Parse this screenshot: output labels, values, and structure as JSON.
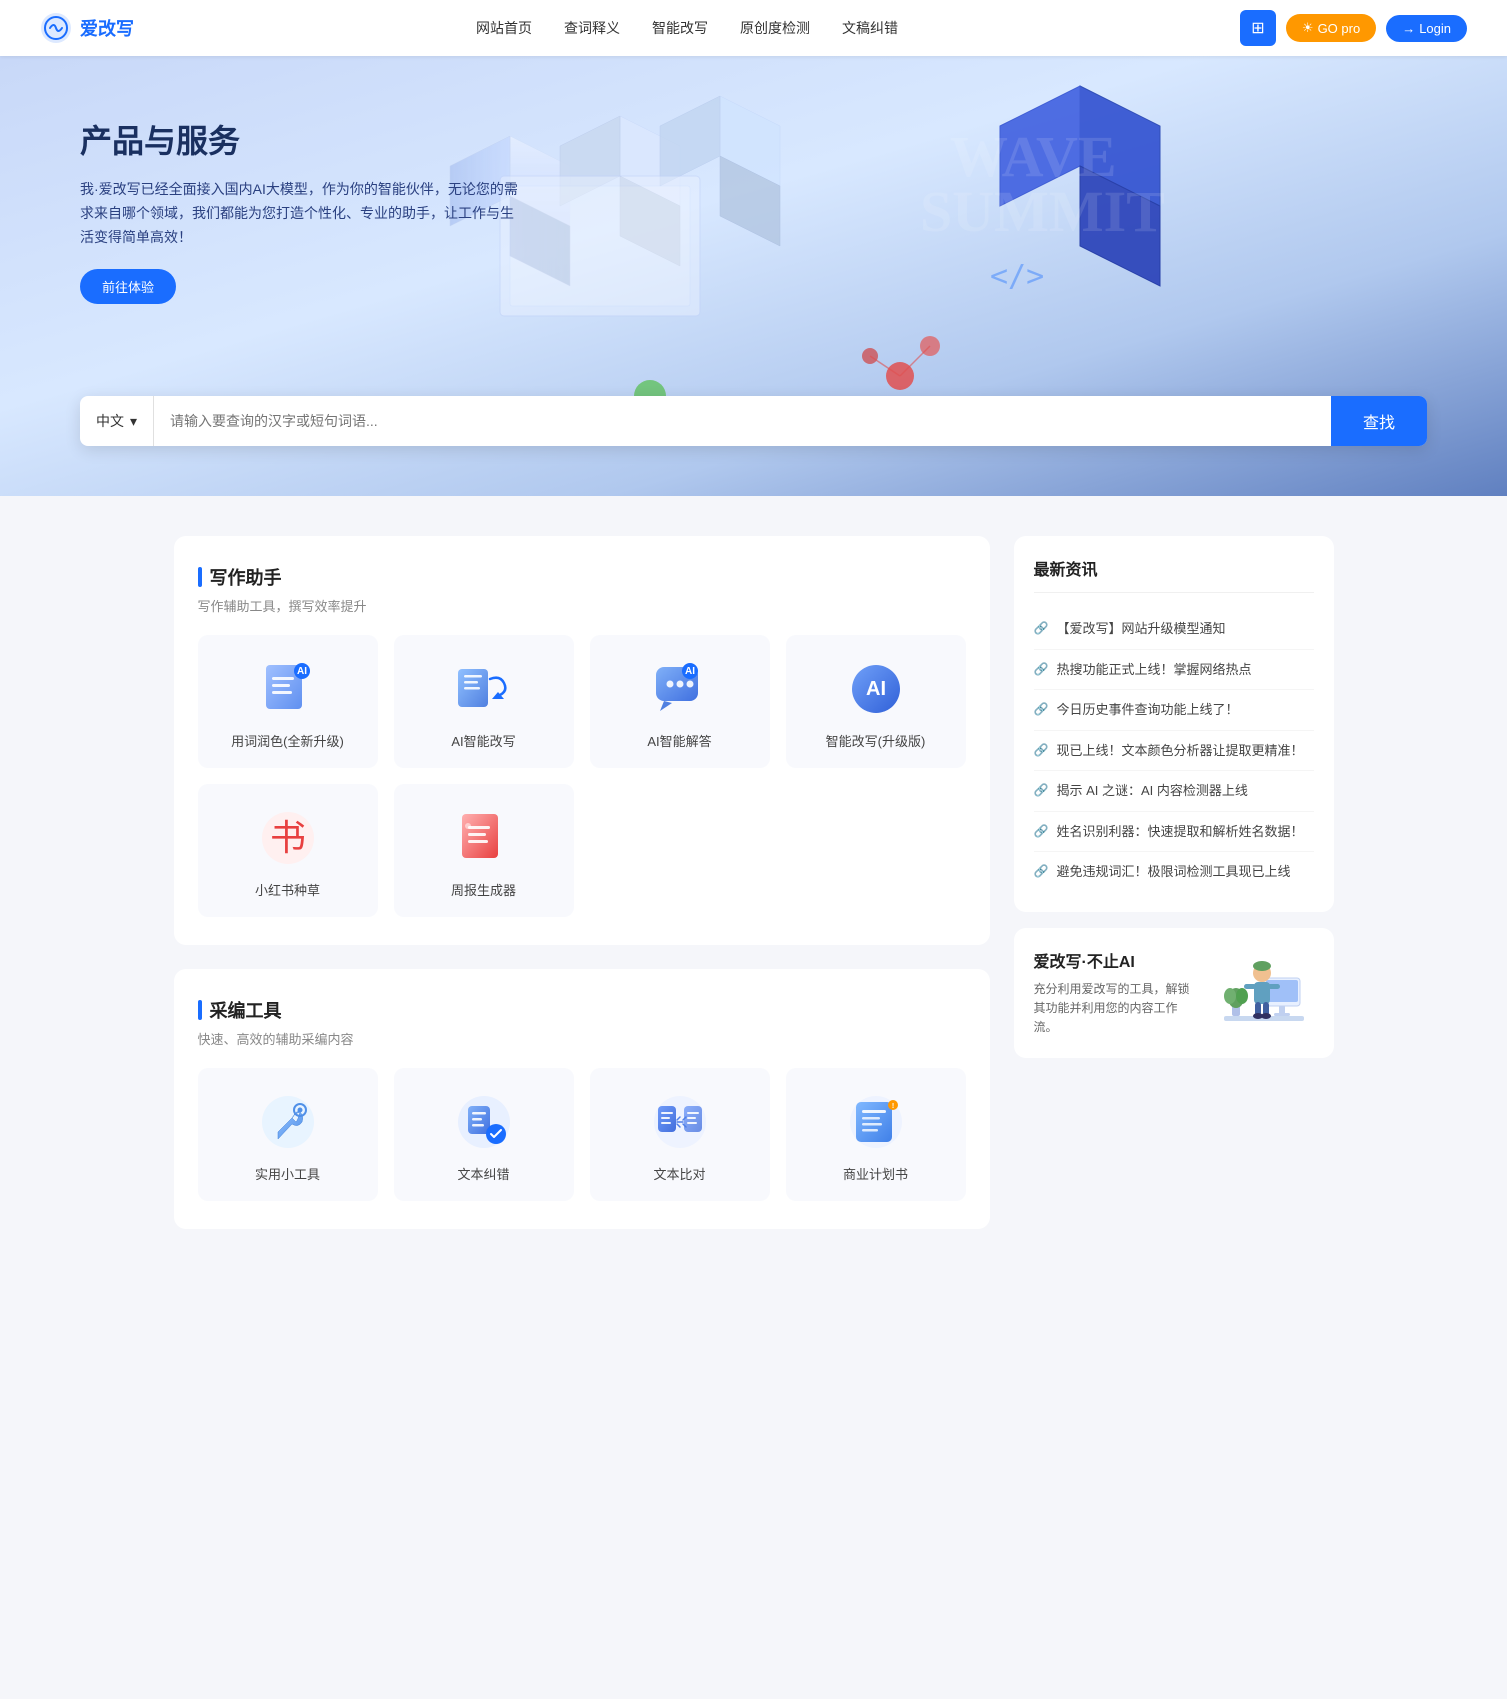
{
  "header": {
    "logo_text": "爱改写",
    "nav_items": [
      "网站首页",
      "查词释义",
      "智能改写",
      "原创度检测",
      "文稿纠错"
    ],
    "btn_grid_label": "⊞",
    "btn_go_label": "GO pro",
    "btn_login_label": "Login"
  },
  "hero": {
    "title": "产品与服务",
    "desc": "我·爱改写已经全面接入国内AI大模型，作为你的智能伙伴，无论您的需求来自哪个领域，我们都能为您打造个性化、专业的助手，让工作与生活变得简单高效！",
    "btn_experience": "前往体验",
    "wave_text": "WAVE SUMMIT",
    "search_lang": "中文",
    "search_placeholder": "请输入要查询的汉字或短句词语...",
    "search_btn": "查找"
  },
  "writing_section": {
    "title": "写作助手",
    "desc": "写作辅助工具，撰写效率提升",
    "tools": [
      {
        "id": "word-polish",
        "label": "用词润色(全新升级)",
        "icon_type": "writing"
      },
      {
        "id": "ai-rewrite",
        "label": "AI智能改写",
        "icon_type": "rewrite"
      },
      {
        "id": "ai-answer",
        "label": "AI智能解答",
        "icon_type": "answer"
      },
      {
        "id": "smart-rewrite-pro",
        "label": "智能改写(升级版)",
        "icon_type": "smart"
      },
      {
        "id": "xiaohongshu",
        "label": "小红书种草",
        "icon_type": "xiaohongshu"
      },
      {
        "id": "weekly-report",
        "label": "周报生成器",
        "icon_type": "weekly"
      }
    ]
  },
  "tools_section": {
    "title": "采编工具",
    "desc": "快速、高效的辅助采编内容",
    "tools": [
      {
        "id": "practical-tools",
        "label": "实用小工具",
        "icon_type": "tools"
      },
      {
        "id": "text-correct",
        "label": "文本纠错",
        "icon_type": "correct"
      },
      {
        "id": "text-compare",
        "label": "文本比对",
        "icon_type": "compare"
      },
      {
        "id": "business-plan",
        "label": "商业计划书",
        "icon_type": "plan"
      }
    ]
  },
  "news": {
    "title": "最新资讯",
    "items": [
      "【爱改写】网站升级模型通知",
      "热搜功能正式上线！掌握网络热点",
      "今日历史事件查询功能上线了！",
      "现已上线！文本颜色分析器让提取更精准！",
      "揭示 AI 之谜：AI 内容检测器上线",
      "姓名识别利器：快速提取和解析姓名数据！",
      "避免违规词汇！极限词检测工具现已上线"
    ]
  },
  "promo": {
    "title": "爱改写·不止AI",
    "desc": "充分利用爱改写的工具，解锁其功能并利用您的内容工作流。"
  },
  "colors": {
    "accent": "#1a6dff",
    "orange": "#ff9800",
    "red": "#e84040",
    "text_main": "#222",
    "text_sub": "#888",
    "bg_card": "#f8f9fd"
  }
}
